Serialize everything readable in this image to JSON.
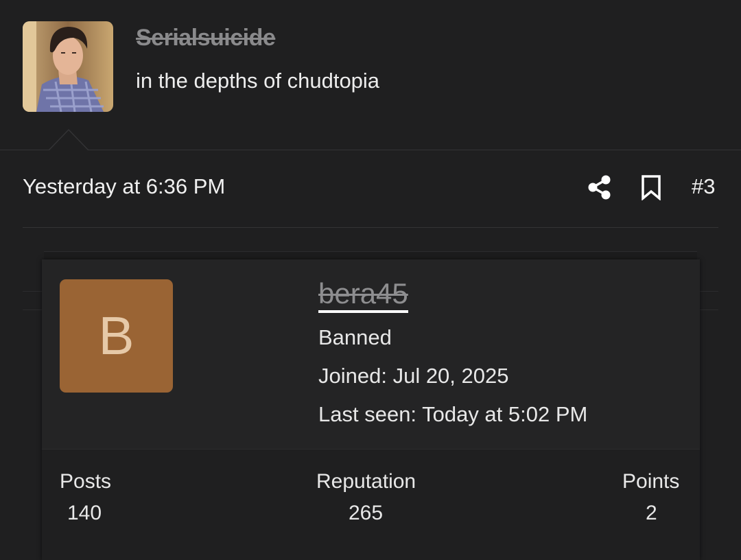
{
  "thread_author": {
    "name": "Serialsuicide",
    "title": "in the depths of chudtopia"
  },
  "post": {
    "timestamp": "Yesterday at 6:36 PM",
    "number": "#3",
    "share_icon": "share-icon",
    "bookmark_icon": "bookmark-icon"
  },
  "member_card": {
    "avatar_letter": "B",
    "avatar_color": "#9a6434",
    "username": "bera45",
    "status": "Banned",
    "joined": "Joined: Jul 20, 2025",
    "last_seen": "Last seen: Today at 5:02 PM",
    "stats": [
      {
        "label": "Posts",
        "value": "140"
      },
      {
        "label": "Reputation",
        "value": "265"
      },
      {
        "label": "Points",
        "value": "2"
      }
    ]
  }
}
